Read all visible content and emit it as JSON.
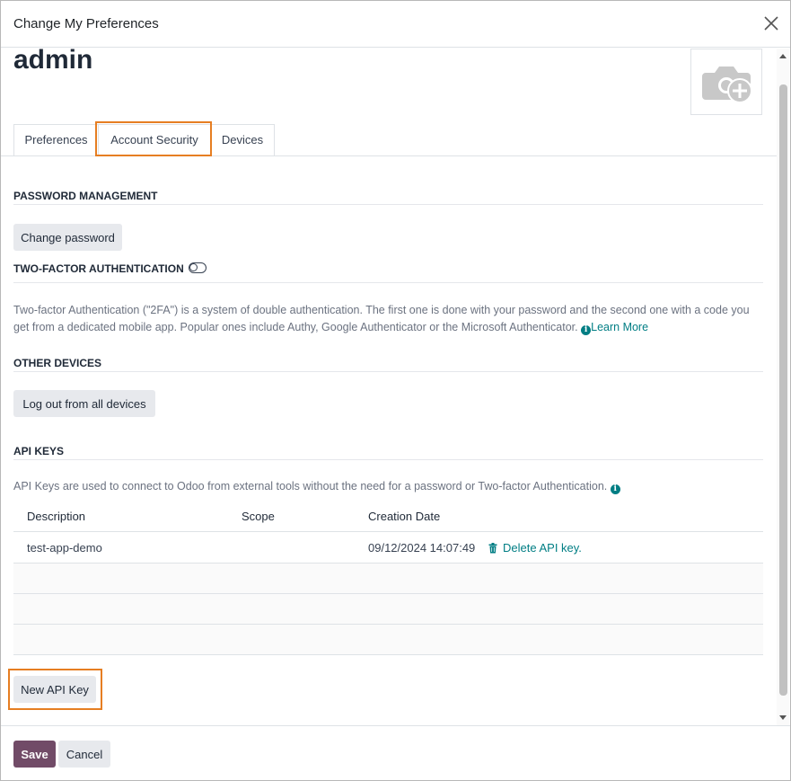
{
  "dialog": {
    "title": "Change My Preferences"
  },
  "user": {
    "name": "admin"
  },
  "tabs": [
    {
      "label": "Preferences",
      "active": false
    },
    {
      "label": "Account Security",
      "active": true
    },
    {
      "label": "Devices",
      "active": false
    }
  ],
  "password_management": {
    "title": "PASSWORD MANAGEMENT",
    "change_password_label": "Change password"
  },
  "two_factor": {
    "title": "TWO-FACTOR AUTHENTICATION",
    "enabled": false,
    "description": "Two-factor Authentication (\"2FA\") is a system of double authentication. The first one is done with your password and the second one with a code you get from a dedicated mobile app. Popular ones include Authy, Google Authenticator or the Microsoft Authenticator.",
    "learn_more_label": "Learn More"
  },
  "other_devices": {
    "title": "OTHER DEVICES",
    "logout_all_label": "Log out from all devices"
  },
  "api_keys": {
    "title": "API KEYS",
    "description": "API Keys are used to connect to Odoo from external tools without the need for a password or Two-factor Authentication.",
    "columns": [
      "Description",
      "Scope",
      "Creation Date"
    ],
    "rows": [
      {
        "description": "test-app-demo",
        "scope": "",
        "creation_date": "09/12/2024 14:07:49",
        "action_label": "Delete API key."
      }
    ],
    "new_key_label": "New API Key"
  },
  "footer": {
    "save_label": "Save",
    "cancel_label": "Cancel"
  },
  "colors": {
    "primary": "#714b67",
    "link": "#017e84",
    "highlight": "#e67e22"
  },
  "icons": {
    "close": "close-icon",
    "avatar": "camera-plus-icon",
    "info": "info-icon",
    "delete": "trash-icon"
  }
}
